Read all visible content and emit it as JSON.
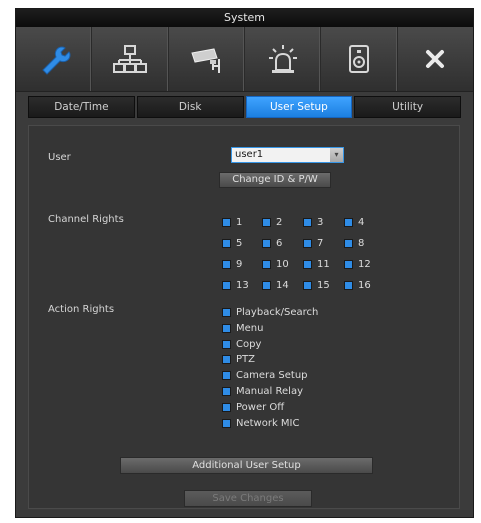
{
  "window": {
    "title": "System"
  },
  "toolbar": {
    "items": [
      {
        "icon": "wrench-icon"
      },
      {
        "icon": "network-icon"
      },
      {
        "icon": "camera-icon"
      },
      {
        "icon": "alarm-icon"
      },
      {
        "icon": "disk-icon"
      },
      {
        "icon": "close-icon"
      }
    ]
  },
  "tabs": [
    {
      "label": "Date/Time",
      "active": false
    },
    {
      "label": "Disk",
      "active": false
    },
    {
      "label": "User Setup",
      "active": true
    },
    {
      "label": "Utility",
      "active": false
    }
  ],
  "user_setup": {
    "user_label": "User",
    "user_value": "user1",
    "change_button": "Change ID & P/W",
    "channel_rights_label": "Channel Rights",
    "channels": [
      "1",
      "2",
      "3",
      "4",
      "5",
      "6",
      "7",
      "8",
      "9",
      "10",
      "11",
      "12",
      "13",
      "14",
      "15",
      "16"
    ],
    "action_rights_label": "Action Rights",
    "actions": [
      "Playback/Search",
      "Menu",
      "Copy",
      "PTZ",
      "Camera Setup",
      "Manual Relay",
      "Power Off",
      "Network MIC"
    ],
    "additional_button": "Additional User Setup",
    "save_button": "Save Changes"
  },
  "colors": {
    "accent": "#2f8ce6",
    "panel": "#353535",
    "tab_active": "#2a8cf0"
  }
}
